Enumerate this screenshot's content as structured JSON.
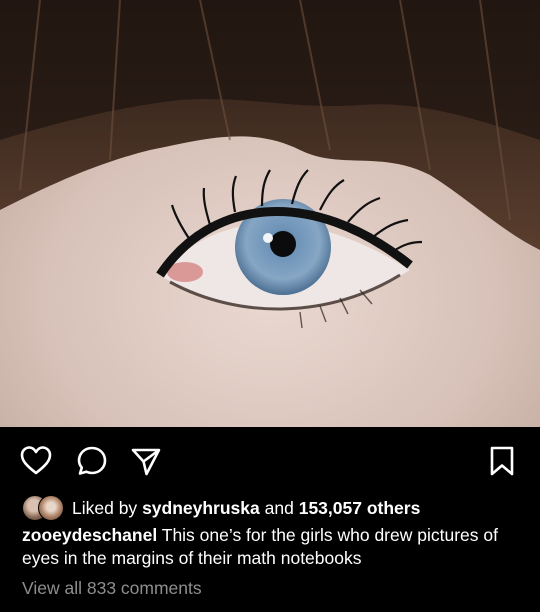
{
  "post": {
    "image_subject": "eye-photo",
    "liked_by_prefix": "Liked by",
    "liked_by_user": "sydneyhruska",
    "liked_by_and": "and",
    "likes_others": "153,057 others",
    "caption_username": "zooeydeschanel",
    "caption_text": "This one’s for the girls who drew pictures of eyes in the margins of their math notebooks",
    "view_comments": "View all 833 comments"
  },
  "icons": {
    "like": "heart-icon",
    "comment": "comment-bubble-icon",
    "share": "paper-plane-icon",
    "save": "bookmark-icon"
  },
  "colors": {
    "background": "#000000",
    "text": "#ffffff",
    "muted": "#8e8e8e"
  }
}
